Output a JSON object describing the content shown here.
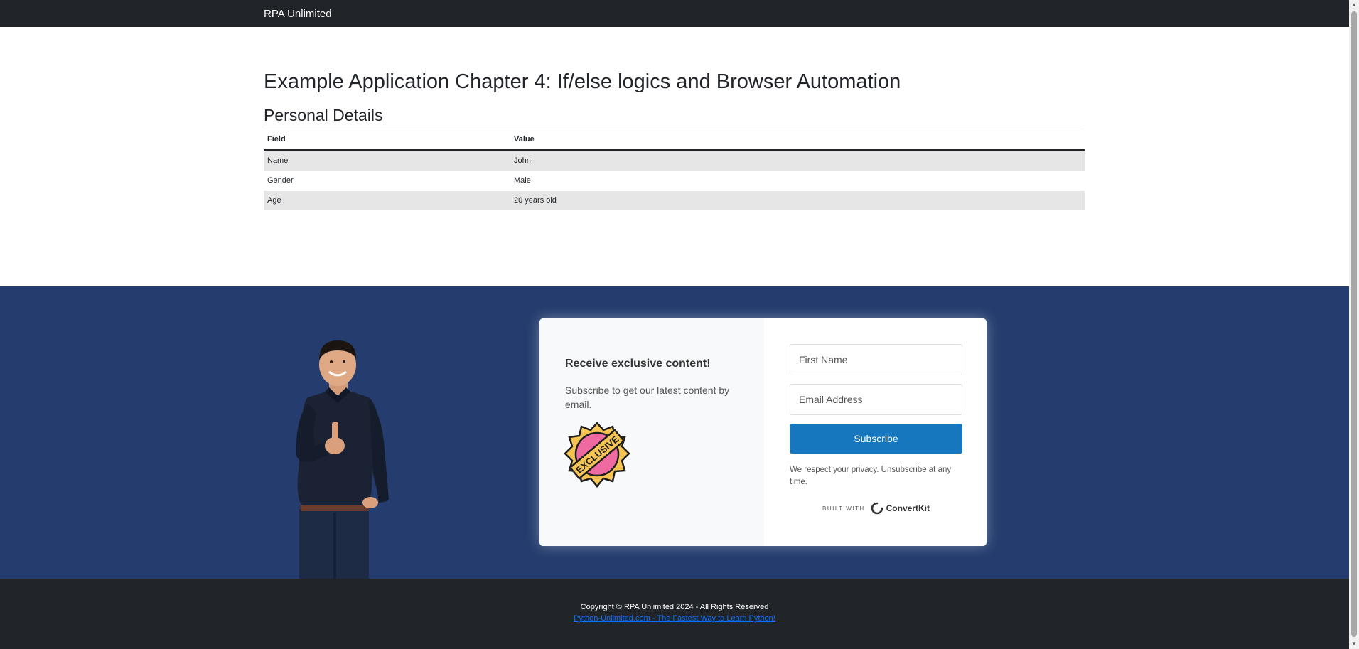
{
  "navbar": {
    "brand": "RPA Unlimited"
  },
  "main": {
    "title": "Example Application Chapter 4: If/else logics and Browser Automation",
    "section_title": "Personal Details",
    "table": {
      "headers": [
        "Field",
        "Value"
      ],
      "rows": [
        [
          "Name",
          "John"
        ],
        [
          "Gender",
          "Male"
        ],
        [
          "Age",
          "20 years old"
        ]
      ]
    }
  },
  "newsletter": {
    "title": "Receive exclusive content!",
    "description": "Subscribe to get our latest content by email.",
    "badge_text": "EXCLUSIVE",
    "first_name_placeholder": "First Name",
    "email_placeholder": "Email Address",
    "subscribe_label": "Subscribe",
    "privacy": "We respect your privacy. Unsubscribe at any time.",
    "built_with": "BUILT WITH",
    "provider": "ConvertKit"
  },
  "footer": {
    "copyright": "Copyright © RPA Unlimited 2024 - All Rights Reserved",
    "link_text": "Python-Unlimited.com - The Fastest Way to Learn Python!"
  },
  "colors": {
    "navbar": "#212529",
    "band": "#253d6e",
    "button": "#1677be",
    "link": "#0d6efd"
  }
}
